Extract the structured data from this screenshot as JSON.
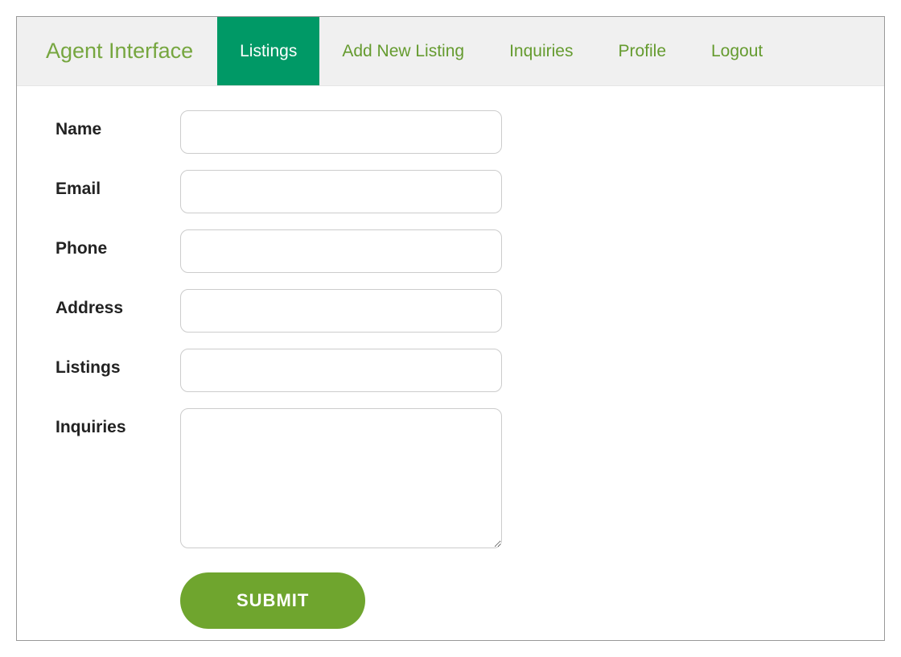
{
  "brand": "Agent Interface",
  "nav": {
    "items": [
      {
        "label": "Listings",
        "active": true
      },
      {
        "label": "Add New Listing",
        "active": false
      },
      {
        "label": "Inquiries",
        "active": false
      },
      {
        "label": "Profile",
        "active": false
      },
      {
        "label": "Logout",
        "active": false
      }
    ]
  },
  "form": {
    "fields": {
      "name": {
        "label": "Name",
        "value": ""
      },
      "email": {
        "label": "Email",
        "value": ""
      },
      "phone": {
        "label": "Phone",
        "value": ""
      },
      "address": {
        "label": "Address",
        "value": ""
      },
      "listings": {
        "label": "Listings",
        "value": ""
      },
      "inquiries": {
        "label": "Inquiries",
        "value": ""
      }
    },
    "submit_label": "SUBMIT"
  }
}
